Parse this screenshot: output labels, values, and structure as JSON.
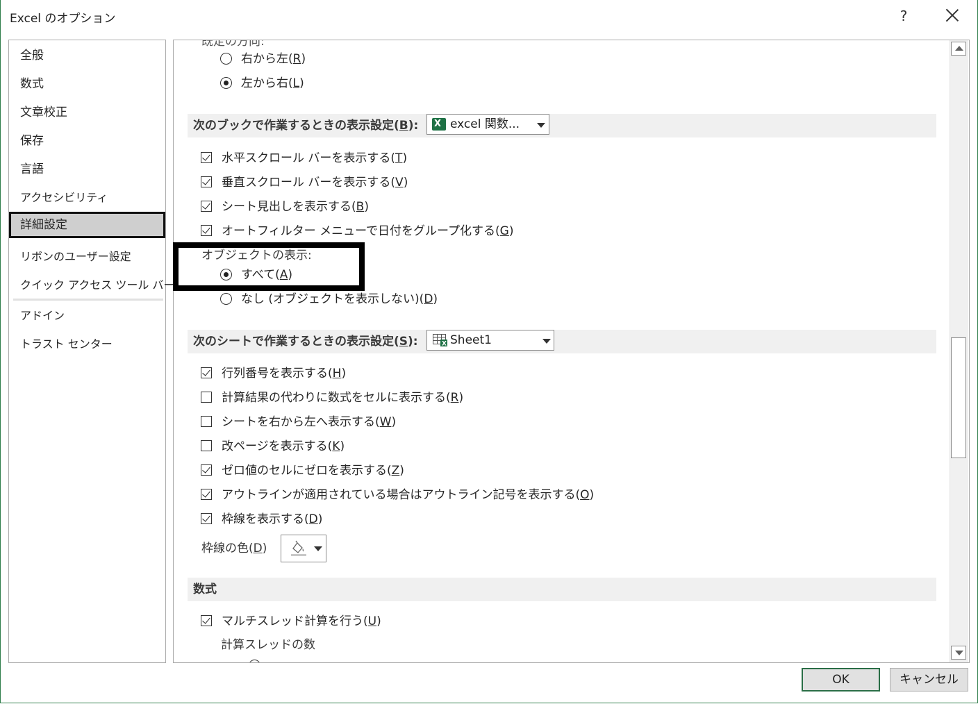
{
  "window": {
    "title": "Excel のオプション",
    "help": "?"
  },
  "sidebar": {
    "items": [
      {
        "label": "全般"
      },
      {
        "label": "数式"
      },
      {
        "label": "文章校正"
      },
      {
        "label": "保存"
      },
      {
        "label": "言語"
      },
      {
        "label": "アクセシビリティ"
      },
      {
        "label": "詳細設定"
      },
      {
        "label": "リボンのユーザー設定"
      },
      {
        "label": "クイック アクセス ツール バー"
      },
      {
        "label": "アドイン"
      },
      {
        "label": "トラスト センター"
      }
    ],
    "selected_index": 6
  },
  "direction": {
    "label_partial": "既定の方向:",
    "rtl": {
      "text": "右から左(",
      "key": "R",
      "close": ")"
    },
    "ltr": {
      "text": "左から右(",
      "key": "L",
      "close": ")"
    }
  },
  "book_section": {
    "header_text": "次のブックで作業するときの表示設定(",
    "header_key": "B",
    "header_close": "):",
    "workbook_value": "excel 関数...",
    "options": [
      {
        "text": "水平スクロール バーを表示する(",
        "key": "T",
        "close": ")",
        "checked": true
      },
      {
        "text": "垂直スクロール バーを表示する(",
        "key": "V",
        "close": ")",
        "checked": true
      },
      {
        "text": "シート見出しを表示する(",
        "key": "B",
        "close": ")",
        "checked": true
      },
      {
        "text": "オートフィルター メニューで日付をグループ化する(",
        "key": "G",
        "close": ")",
        "checked": true
      }
    ],
    "objects_label": "オブジェクトの表示:",
    "objects_all": {
      "text": "すべて(",
      "key": "A",
      "close": ")"
    },
    "objects_none": {
      "text": "なし (オブジェクトを表示しない)(",
      "key": "D",
      "close": ")"
    }
  },
  "sheet_section": {
    "header_text": "次のシートで作業するときの表示設定(",
    "header_key": "S",
    "header_close": "):",
    "sheet_value": "Sheet1",
    "options": [
      {
        "text": "行列番号を表示する(",
        "key": "H",
        "close": ")",
        "checked": true
      },
      {
        "text": "計算結果の代わりに数式をセルに表示する(",
        "key": "R",
        "close": ")",
        "checked": false
      },
      {
        "text": "シートを右から左へ表示する(",
        "key": "W",
        "close": ")",
        "checked": false
      },
      {
        "text": "改ページを表示する(",
        "key": "K",
        "close": ")",
        "checked": false
      },
      {
        "text": "ゼロ値のセルにゼロを表示する(",
        "key": "Z",
        "close": ")",
        "checked": true
      },
      {
        "text": "アウトラインが適用されている場合はアウトライン記号を表示する(",
        "key": "O",
        "close": ")",
        "checked": true
      },
      {
        "text": "枠線を表示する(",
        "key": "D",
        "close": ")",
        "checked": true
      }
    ],
    "gridline_color_text": "枠線の色(",
    "gridline_color_key": "D",
    "gridline_color_close": ")"
  },
  "formula_section": {
    "header": "数式",
    "multithread": {
      "text": "マルチスレッド計算を行う(",
      "key": "U",
      "close": ")",
      "checked": true
    },
    "threads_label": "計算スレッドの数"
  },
  "buttons": {
    "ok": "OK",
    "cancel": "キャンセル"
  },
  "colors": {
    "accent_green": "#1e7145",
    "ok_border": "#2a6e46"
  }
}
